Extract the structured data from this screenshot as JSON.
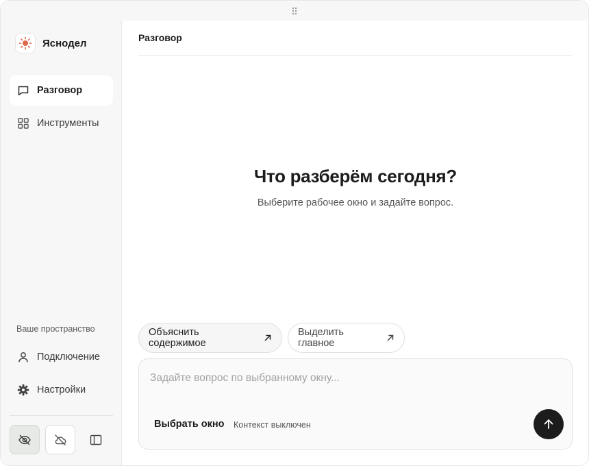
{
  "app": {
    "name": "Яснодел",
    "logo_icon": "sun-icon",
    "accent_color": "#e0694a"
  },
  "sidebar": {
    "items": [
      {
        "label": "Разговор",
        "icon": "chat-bubble-icon",
        "active": true
      },
      {
        "label": "Инструменты",
        "icon": "grid-icon",
        "active": false
      }
    ],
    "section_label": "Ваше пространство",
    "bottom_items": [
      {
        "label": "Подключение",
        "icon": "user-icon"
      },
      {
        "label": "Настройки",
        "icon": "gear-icon"
      }
    ],
    "toggles": [
      {
        "icon": "eye-off-icon",
        "active": true
      },
      {
        "icon": "cloud-off-icon",
        "active": false
      },
      {
        "icon": "sidebar-panel-icon",
        "active": false
      }
    ]
  },
  "main": {
    "title": "Разговор",
    "heading": "Что разберём сегодня?",
    "subheading": "Выберите рабочее окно и задайте вопрос.",
    "suggestions": [
      {
        "label": "Объяснить содержимое",
        "icon": "arrow-up-right-icon"
      },
      {
        "label": "Выделить главное",
        "icon": "arrow-up-right-icon"
      }
    ],
    "composer": {
      "placeholder": "Задайте вопрос по выбранному окну...",
      "value": "",
      "pick_window_label": "Выбрать окно",
      "context_status": "Контекст выключен",
      "send_icon": "arrow-up-icon"
    }
  }
}
